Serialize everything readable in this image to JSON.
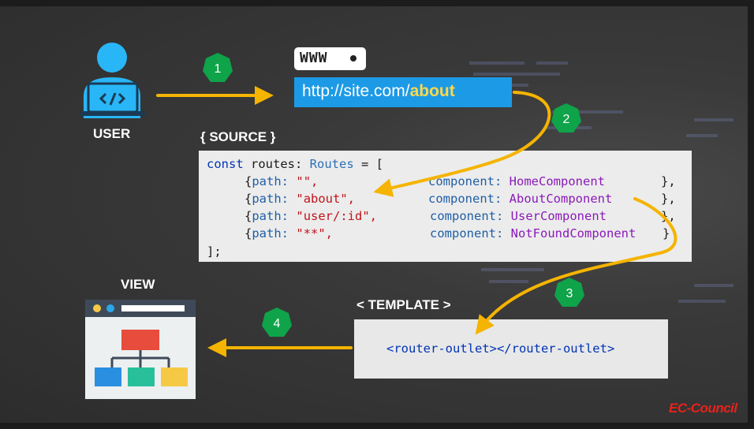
{
  "labels": {
    "user": "USER",
    "source": "{ SOURCE }",
    "view": "VIEW",
    "template": "< TEMPLATE >"
  },
  "browser": {
    "www": "WWW",
    "url_prefix": "http://site.com/",
    "url_path": "about"
  },
  "code": {
    "line1": {
      "kw": "const",
      "rest": " routes: ",
      "type": "Routes",
      "end": " = ["
    },
    "routes": [
      {
        "path": "\"\",",
        "comp": "HomeComponent",
        "end": "},"
      },
      {
        "path": "\"about\",",
        "comp": "AboutComponent",
        "end": "},"
      },
      {
        "path": "\"user/:id\",",
        "comp": "UserComponent",
        "end": "},"
      },
      {
        "path": "\"**\",",
        "comp": "NotFoundComponent",
        "end": "}"
      }
    ],
    "prop_path": "path:",
    "prop_component": "component:",
    "open_brace": "{",
    "close": "];"
  },
  "template_code": "<router-outlet></router-outlet>",
  "steps": [
    "1",
    "2",
    "3",
    "4"
  ],
  "brand": "EC-Council",
  "colors": {
    "arrow": "#f5b400",
    "badge": "#0fa34a",
    "url_bg": "#1c9ae6",
    "user_icon": "#29b6f6"
  }
}
